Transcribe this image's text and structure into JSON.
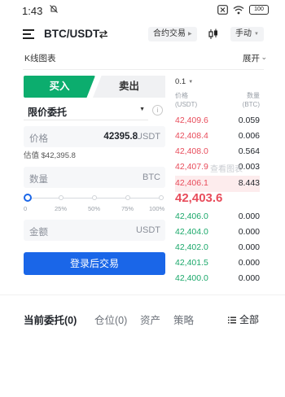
{
  "status_bar": {
    "time": "1:43",
    "battery": "100"
  },
  "header": {
    "pair": "BTC/USDT",
    "mode_pill": "合约交易",
    "margin_pill": "手动"
  },
  "kline": {
    "title": "K线图表",
    "expand_label": "展开"
  },
  "order_form": {
    "buy_tab": "买入",
    "sell_tab": "卖出",
    "order_type": "限价委托",
    "price_label": "价格",
    "price_value": "42395.8",
    "price_unit": "USDT",
    "estimate": "估值 $42,395.8",
    "qty_label": "数量",
    "qty_unit": "BTC",
    "slider_ticks": [
      "0",
      "25%",
      "50%",
      "75%",
      "100%"
    ],
    "slider_value": 0,
    "amount_label": "金额",
    "amount_unit": "USDT",
    "login_button": "登录后交易"
  },
  "orderbook": {
    "precision": "0.1",
    "price_header": [
      "价格",
      "(USDT)"
    ],
    "qty_header": [
      "数量",
      "(BTC)"
    ],
    "asks": [
      {
        "price": "42,409.6",
        "qty": "0.059"
      },
      {
        "price": "42,408.4",
        "qty": "0.006"
      },
      {
        "price": "42,408.0",
        "qty": "0.564"
      },
      {
        "price": "42,407.9",
        "qty": "0.003"
      },
      {
        "price": "42,406.1",
        "qty": "8.443"
      }
    ],
    "last_price": "42,403.6",
    "bids": [
      {
        "price": "42,406.0",
        "qty": "0.000"
      },
      {
        "price": "42,404.0",
        "qty": "0.000"
      },
      {
        "price": "42,402.0",
        "qty": "0.000"
      },
      {
        "price": "42,401.5",
        "qty": "0.000"
      },
      {
        "price": "42,400.0",
        "qty": "0.000"
      }
    ],
    "watermark": "查看图表"
  },
  "bottom_tabs": {
    "items": [
      "当前委托(0)",
      "仓位(0)",
      "资产",
      "策略"
    ],
    "all_label": "全部"
  },
  "colors": {
    "buy": "#0cad6e",
    "ask": "#e84c5b",
    "bid": "#1aa86a",
    "primary": "#1a66e8"
  }
}
